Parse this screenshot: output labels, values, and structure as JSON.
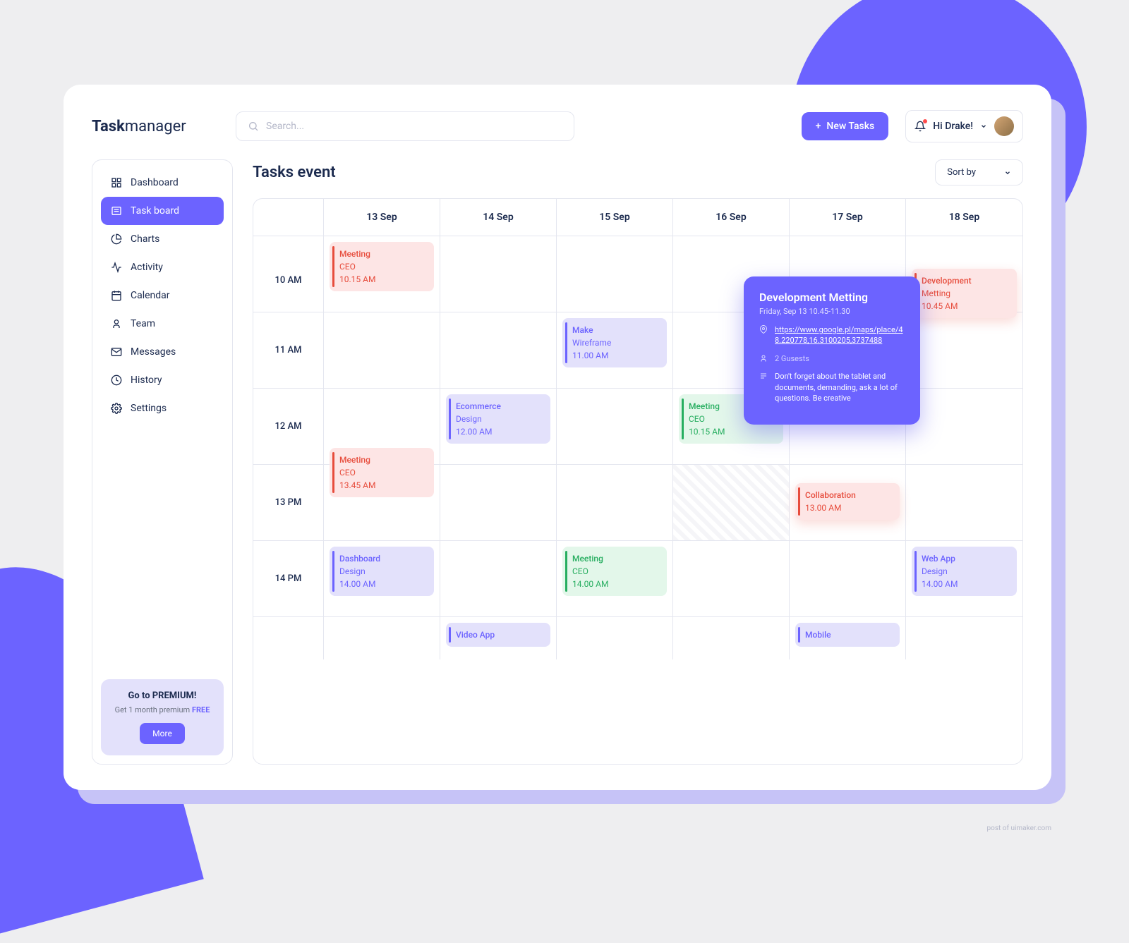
{
  "logo": {
    "bold": "Task",
    "rest": "manager"
  },
  "search": {
    "placeholder": "Search..."
  },
  "header": {
    "newTaskLabel": "New Tasks",
    "greeting": "Hi Drake!"
  },
  "sidebar": {
    "items": [
      {
        "label": "Dashboard",
        "icon": "grid"
      },
      {
        "label": "Task board",
        "icon": "board",
        "active": true
      },
      {
        "label": "Charts",
        "icon": "pie"
      },
      {
        "label": "Activity",
        "icon": "activity"
      },
      {
        "label": "Calendar",
        "icon": "calendar"
      },
      {
        "label": "Team",
        "icon": "user"
      },
      {
        "label": "Messages",
        "icon": "mail"
      },
      {
        "label": "History",
        "icon": "clock"
      },
      {
        "label": "Settings",
        "icon": "gear"
      }
    ],
    "promo": {
      "title": "Go to PREMIUM!",
      "sub1": "Get 1 month premium",
      "sub2": "FREE",
      "button": "More"
    }
  },
  "main": {
    "title": "Tasks event",
    "sortLabel": "Sort by"
  },
  "calendar": {
    "days": [
      "13 Sep",
      "14 Sep",
      "15 Sep",
      "16 Sep",
      "17 Sep",
      "18 Sep"
    ],
    "times": [
      "10 AM",
      "11 AM",
      "12 AM",
      "13 PM",
      "14 PM",
      ""
    ],
    "events": {
      "r0c0": {
        "title": "Meeting",
        "sub": "CEO",
        "time": "10.15 AM",
        "color": "red"
      },
      "r1c2": {
        "title": "Make",
        "sub": "Wireframe",
        "time": "11.00 AM",
        "color": "purple"
      },
      "r0c5": {
        "title": "Development",
        "sub": "Metting",
        "time": "10.45 AM",
        "color": "red",
        "shadow": true
      },
      "r2c1": {
        "title": "Ecommerce",
        "sub": "Design",
        "time": "12.00 AM",
        "color": "purple"
      },
      "r2c3": {
        "title": "Meeting",
        "sub": "CEO",
        "time": "10.15 AM",
        "color": "green"
      },
      "r3c0": {
        "title": "Meeting",
        "sub": "CEO",
        "time": "13.45 AM",
        "color": "red"
      },
      "r3c4": {
        "title": "Collaboration",
        "sub": "",
        "time": "13.00 AM",
        "color": "red",
        "shadow": true
      },
      "r4c0": {
        "title": "Dashboard",
        "sub": "Design",
        "time": "14.00 AM",
        "color": "purple"
      },
      "r4c2": {
        "title": "Meeting",
        "sub": "CEO",
        "time": "14.00 AM",
        "color": "green"
      },
      "r4c5": {
        "title": "Web App",
        "sub": "Design",
        "time": "14.00 AM",
        "color": "purple"
      },
      "r5c1": {
        "title": "Video App",
        "sub": "",
        "time": "",
        "color": "purple"
      },
      "r5c4": {
        "title": "Mobile",
        "sub": "",
        "time": "",
        "color": "purple"
      }
    }
  },
  "popover": {
    "title": "Development Metting",
    "date": "Friday, Sep 13 10.45-11.30",
    "link": "https://www.google.pl/maps/place/48.220778,16.3100205,3737488",
    "guests": "2 Gusests",
    "note": "Don't forget about the tablet and documents, demanding, ask a lot of questions. Be creative"
  },
  "footnote": "post of uimaker.com"
}
